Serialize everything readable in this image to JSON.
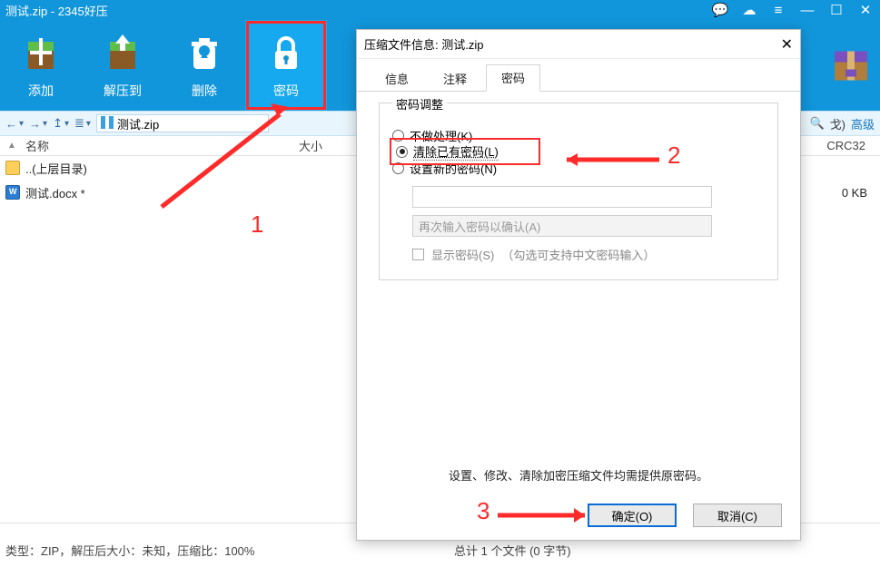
{
  "window": {
    "title": "测试.zip - 2345好压"
  },
  "toolbar": {
    "add": "添加",
    "extract": "解压到",
    "delete": "删除",
    "password": "密码"
  },
  "navbar": {
    "path_text": "测试.zip",
    "right_segment": "戈)",
    "right_link": "高级"
  },
  "columns": {
    "name": "名称",
    "size": "大小",
    "crc": "CRC32"
  },
  "rows": {
    "parent": "..(上层目录)",
    "file1_name": "测试.docx *",
    "file1_size": "0 KB"
  },
  "status": {
    "left": "类型：ZIP，解压后大小：未知，压缩比：100%",
    "right": "总计 1 个文件 (0 字节)"
  },
  "dialog": {
    "title": "压缩文件信息: 测试.zip",
    "tabs": {
      "info": "信息",
      "comment": "注释",
      "password": "密码"
    },
    "legend": "密码调整",
    "opt_none": "不做处理(K)",
    "opt_clear": "清除已有密码(L)",
    "opt_set": "设置新的密码(N)",
    "confirm_placeholder": "再次输入密码以确认(A)",
    "show_password": "显示密码(S)",
    "show_note": "（勾选可支持中文密码输入）",
    "bottom_note": "设置、修改、清除加密压缩文件均需提供原密码。",
    "ok": "确定(O)",
    "cancel": "取消(C)"
  },
  "annotations": {
    "n1": "1",
    "n2": "2",
    "n3": "3"
  }
}
